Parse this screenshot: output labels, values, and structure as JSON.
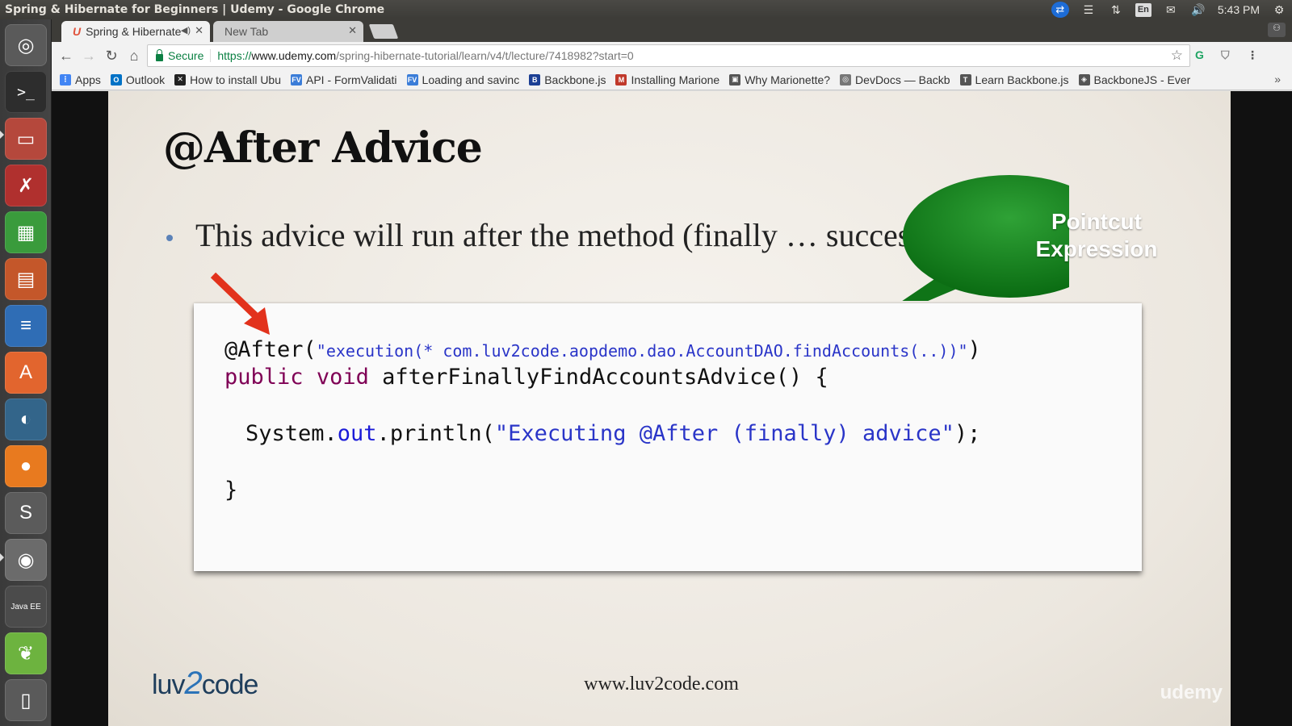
{
  "window": {
    "title": "Spring & Hibernate for Beginners | Udemy - Google Chrome"
  },
  "tray": {
    "lang": "En",
    "time": "5:43 PM"
  },
  "tabs": [
    {
      "label": "Spring & Hibernate",
      "favicon": "U"
    },
    {
      "label": "New Tab"
    }
  ],
  "address": {
    "secure_label": "Secure",
    "scheme": "https://",
    "host": "www.udemy.com",
    "path": "/spring-hibernate-tutorial/learn/v4/t/lecture/7418982?start=0"
  },
  "bookmarks": [
    {
      "label": "Apps",
      "icon_color": "#4285f4",
      "icon": "⋮"
    },
    {
      "label": "Outlook",
      "icon_color": "#0072c6",
      "icon": "O"
    },
    {
      "label": "How to install Ubu",
      "icon_color": "#222222",
      "icon": "✕"
    },
    {
      "label": "API - FormValidati",
      "icon_color": "#3b7dd8",
      "icon": "FV"
    },
    {
      "label": "Loading and savinc",
      "icon_color": "#3b7dd8",
      "icon": "FV"
    },
    {
      "label": "Backbone.js",
      "icon_color": "#1c3f94",
      "icon": "B"
    },
    {
      "label": "Installing Marione",
      "icon_color": "#c0392b",
      "icon": "M"
    },
    {
      "label": "Why Marionette?",
      "icon_color": "#555555",
      "icon": "▣"
    },
    {
      "label": "DevDocs — Backb",
      "icon_color": "#777777",
      "icon": "◎"
    },
    {
      "label": "Learn Backbone.js",
      "icon_color": "#555555",
      "icon": "T"
    },
    {
      "label": "BackboneJS - Ever",
      "icon_color": "#555555",
      "icon": "◈"
    }
  ],
  "slide": {
    "title": "@After Advice",
    "bullet": "This advice will run after the method (finally … success / failure)",
    "callout": [
      "Pointcut",
      "Expression"
    ],
    "code": {
      "line1_annotation": "@After(",
      "line1_string": "\"execution(* com.luv2code.aopdemo.dao.AccountDAO.findAccounts(..))\"",
      "line1_close": ")",
      "line2_kw1": "public",
      "line2_kw2": "void",
      "line2_rest": "afterFinallyFindAccountsAdvice() {",
      "line3_obj": "System.",
      "line3_field": "out",
      "line3_call": ".println(",
      "line3_string": "\"Executing @After (finally) advice\"",
      "line3_end": ");",
      "line4": "}"
    },
    "footer_url": "www.luv2code.com",
    "logo": {
      "pre": "luv",
      "num": "2",
      "post": "code"
    },
    "watermark": "udemy"
  }
}
